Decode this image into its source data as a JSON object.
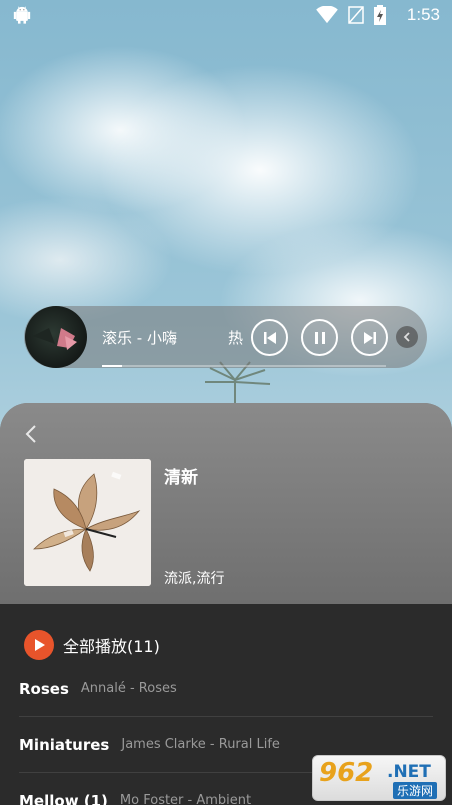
{
  "status_bar": {
    "time": "1:53",
    "icons": [
      "android-icon",
      "wifi-icon",
      "no-signal-icon",
      "battery-charging-icon"
    ]
  },
  "mini_player": {
    "track": "滚乐 - 小嗨",
    "extra_text": "热",
    "progress": 0.07,
    "controls": [
      "previous-icon",
      "pause-icon",
      "next-icon",
      "chevron-left-icon"
    ]
  },
  "album": {
    "title": "清新",
    "genre": "流派,流行"
  },
  "play_all": {
    "label": "全部播放(11)",
    "accent": "#e8542b"
  },
  "songs": [
    {
      "title": "Roses",
      "artist": "Annalé - Roses"
    },
    {
      "title": "Miniatures",
      "artist": "James  Clarke - Rural Life"
    },
    {
      "title": "Mellow (1)",
      "artist": "Mo  Foster - Ambient"
    }
  ],
  "watermark": {
    "number": "962",
    "suffix": ".NET",
    "subtitle": "乐游网"
  }
}
